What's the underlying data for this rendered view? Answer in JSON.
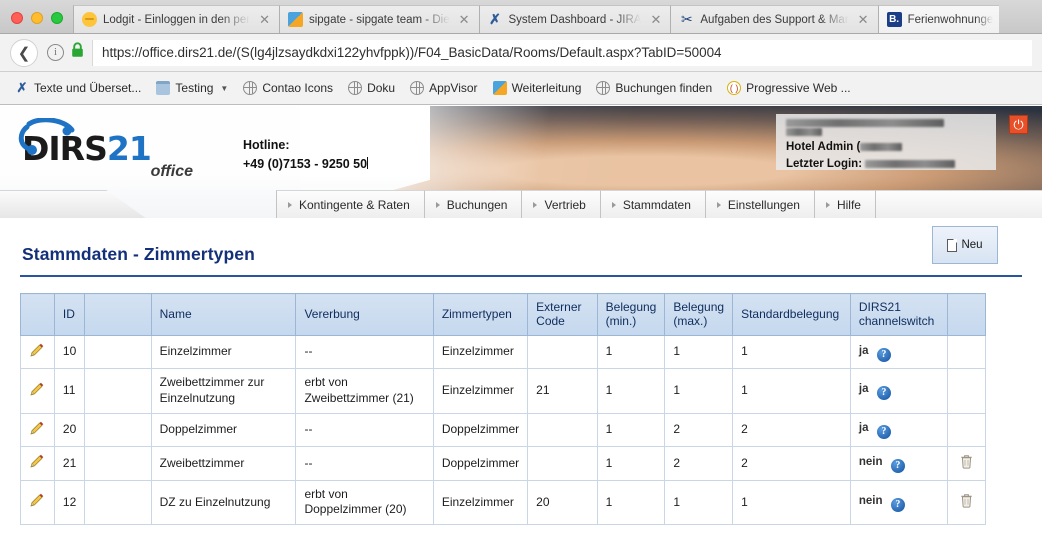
{
  "browser": {
    "tabs": [
      {
        "title": "Lodgit - Einloggen in den per",
        "favicon": "lodgit-icon",
        "active": false
      },
      {
        "title": "sipgate - sipgate team - Die",
        "favicon": "sipgate-icon",
        "active": false
      },
      {
        "title": "System Dashboard - JIRA",
        "favicon": "jira-icon",
        "active": false
      },
      {
        "title": "Aufgaben des Support & Mar",
        "favicon": "scissors-icon",
        "active": false
      },
      {
        "title": "Ferienwohnunge",
        "favicon": "booking-icon",
        "active": true
      }
    ],
    "close_glyph": "✕",
    "back_glyph": "❮",
    "url": "https://office.dirs21.de/(S(lg4jlzsaydkdxi122yhvfppk))/F04_BasicData/Rooms/Default.aspx?TabID=50004",
    "info_glyph": "i",
    "bookmarks": [
      {
        "label": "Texte und Überset...",
        "icon": "jira-icon",
        "caret": false
      },
      {
        "label": "Testing",
        "icon": "folder-icon",
        "caret": true
      },
      {
        "label": "Contao Icons",
        "icon": "globe-icon",
        "caret": false
      },
      {
        "label": "Doku",
        "icon": "globe-icon",
        "caret": false
      },
      {
        "label": "AppVisor",
        "icon": "globe-icon",
        "caret": false
      },
      {
        "label": "Weiterleitung",
        "icon": "sipgate-icon",
        "caret": false
      },
      {
        "label": "Buchungen finden",
        "icon": "globe-icon",
        "caret": false
      },
      {
        "label": "Progressive Web ...",
        "icon": "pwa-icon",
        "caret": false
      }
    ]
  },
  "app": {
    "logo": {
      "part1": "DIRS",
      "part2": "21",
      "sub": "office"
    },
    "hotline": {
      "label": "Hotline:",
      "number": "+49 (0)7153 - 9250 50"
    },
    "user": {
      "admin_label": "Hotel Admin (",
      "login_label": "Letzter Login:"
    },
    "logout_glyph": "⏻",
    "nav": [
      {
        "label": "Kontingente & Raten"
      },
      {
        "label": "Buchungen"
      },
      {
        "label": "Vertrieb"
      },
      {
        "label": "Stammdaten"
      },
      {
        "label": "Einstellungen"
      },
      {
        "label": "Hilfe"
      }
    ]
  },
  "main": {
    "title": "Stammdaten - Zimmertypen",
    "new_button": "Neu",
    "table": {
      "columns": [
        "",
        "ID",
        "",
        "Name",
        "Vererbung",
        "Zimmertypen",
        "Externer Code",
        "Belegung (min.)",
        "Belegung (max.)",
        "Standardbelegung",
        "DIRS21 channelswitch",
        ""
      ],
      "columns_split": {
        "extern": [
          "Externer",
          "Code"
        ],
        "belmin": [
          "Belegung",
          "(min.)"
        ],
        "belmax": [
          "Belegung",
          "(max.)"
        ],
        "chsw": [
          "DIRS21",
          "channelswitch"
        ]
      },
      "rows": [
        {
          "id": "10",
          "name": "Einzelzimmer",
          "vererbung": "--",
          "zimmertyp": "Einzelzimmer",
          "extern_code": "",
          "bel_min": "1",
          "bel_max": "1",
          "std_bel": "1",
          "channelswitch": "ja",
          "deletable": false
        },
        {
          "id": "11",
          "name": "Zweibettzimmer zur Einzelnutzung",
          "vererbung": "erbt von Zweibettzimmer (21)",
          "zimmertyp": "Einzelzimmer",
          "extern_code": "21",
          "bel_min": "1",
          "bel_max": "1",
          "std_bel": "1",
          "channelswitch": "ja",
          "deletable": false
        },
        {
          "id": "20",
          "name": "Doppelzimmer",
          "vererbung": "--",
          "zimmertyp": "Doppelzimmer",
          "extern_code": "",
          "bel_min": "1",
          "bel_max": "2",
          "std_bel": "2",
          "channelswitch": "ja",
          "deletable": false
        },
        {
          "id": "21",
          "name": "Zweibettzimmer",
          "vererbung": "--",
          "zimmertyp": "Doppelzimmer",
          "extern_code": "",
          "bel_min": "1",
          "bel_max": "2",
          "std_bel": "2",
          "channelswitch": "nein",
          "deletable": true
        },
        {
          "id": "12",
          "name": "DZ zu Einzelnutzung",
          "vererbung": "erbt von Doppelzimmer (20)",
          "zimmertyp": "Einzelzimmer",
          "extern_code": "20",
          "bel_min": "1",
          "bel_max": "1",
          "std_bel": "1",
          "channelswitch": "nein",
          "deletable": true
        }
      ],
      "help_glyph": "?"
    }
  },
  "colors": {
    "brand_blue": "#1f73c4",
    "title_blue": "#14307a",
    "header_row": "#c5d8ee",
    "logout_orange": "#e8502a"
  }
}
